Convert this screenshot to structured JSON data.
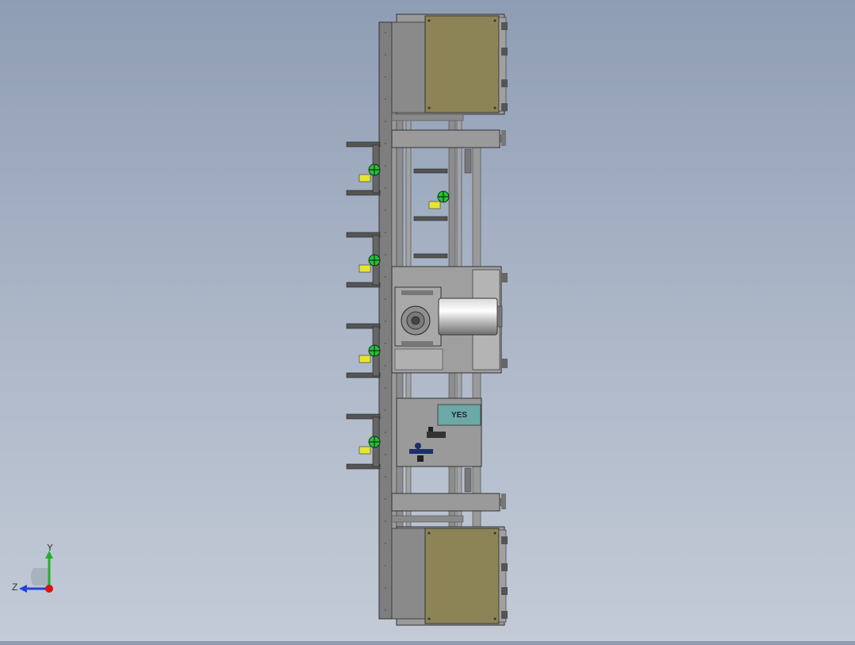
{
  "viewport": {
    "background_top": "#8f9db4",
    "background_bottom": "#c3cbd6"
  },
  "model": {
    "colors": {
      "frame": "#8e8e8e",
      "frame_dark": "#4a4a4a",
      "enclosure": "#8c8456",
      "sensor_green": "#22c232",
      "sensor_yellow": "#e6e632",
      "label_panel": "#6aa9a5"
    },
    "control_panel_label": "YES"
  },
  "triad": {
    "y_label": "Y",
    "z_label": "Z",
    "y_color": "#22b02a",
    "z_color": "#2244dd",
    "x_color": "#dd1111"
  }
}
